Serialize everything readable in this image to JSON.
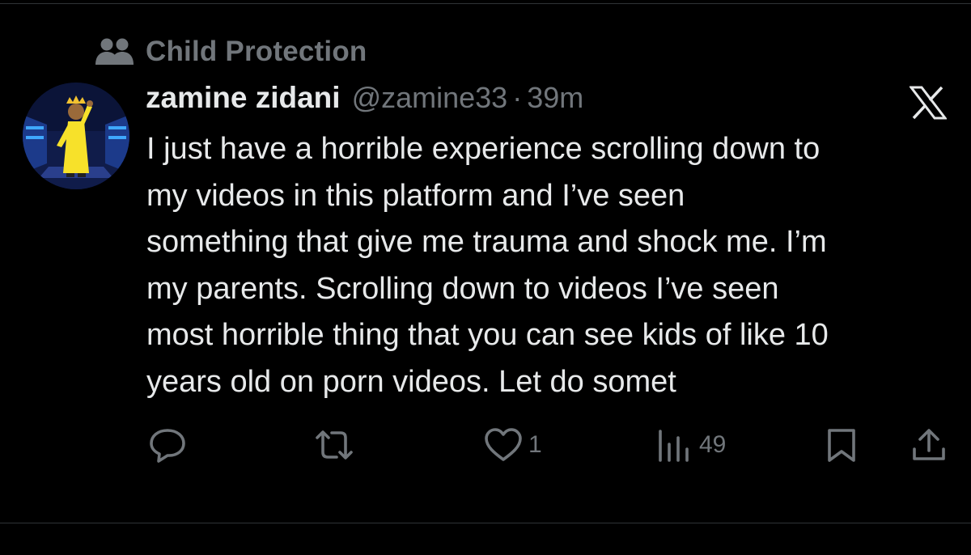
{
  "context": {
    "icon": "people-icon",
    "label": "Child Protection"
  },
  "post": {
    "display_name": "zamine zidani",
    "handle": "@zamine33",
    "separator": "·",
    "time": "39m",
    "text": "I just have a horrible experience scrolling down to\nmy videos in this platform and I’ve seen\nsomething that give me trauma and shock me. I’m\nmy parents. Scrolling down to videos I’ve seen\nmost horrible thing that you can see kids of like 10\nyears old on porn videos. Let do somet",
    "platform_logo": "x-logo-icon"
  },
  "actions": {
    "reply": {
      "icon": "reply-icon"
    },
    "repost": {
      "icon": "repost-icon"
    },
    "like": {
      "icon": "heart-icon",
      "count": "1"
    },
    "views": {
      "icon": "views-icon",
      "count": "49"
    },
    "bookmark": {
      "icon": "bookmark-icon"
    },
    "share": {
      "icon": "share-icon"
    }
  },
  "colors": {
    "background": "#000000",
    "primary_text": "#e7e9ea",
    "secondary_text": "#71767b",
    "divider": "#2f3336"
  }
}
